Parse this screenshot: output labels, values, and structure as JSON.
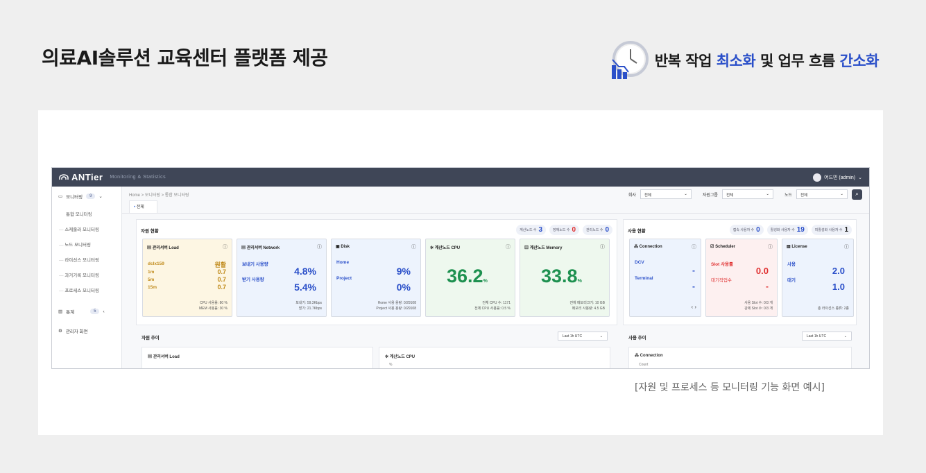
{
  "headline": "의료AI솔루션 교육센터 플랫폼 제공",
  "tagline": {
    "p1": "반복 작업 ",
    "h1": "최소화",
    "p2": " 및 업무 흐름 ",
    "h2": "간소화"
  },
  "caption": "[자원 및 프로세스 등 모니터링 기능 화면 예시]",
  "app": {
    "logo": "ANTier",
    "logo_sub": "Monitoring & Statistics",
    "user": "어드민 (admin)",
    "sidebar": {
      "monitoring": "모니터링",
      "monitoring_count": "9",
      "items": [
        "통합 모니터링",
        "스케줄러 모니터링",
        "노드 모니터링",
        "라이선스 모니터링",
        "과거기록 모니터링",
        "프로세스 모니터링"
      ],
      "stats": "통계",
      "stats_count": "5",
      "admin": "관리자 화면"
    },
    "breadcrumb": "Home  >  모니터링  >  통합 모니터링",
    "filters": {
      "company_label": "회사",
      "company_value": "전체",
      "group_label": "자원그룹",
      "group_value": "전체",
      "node_label": "노드",
      "node_value": "전체"
    },
    "tab": "전체",
    "resource": {
      "title": "자원 현황",
      "chips": [
        {
          "label": "계산노드 수",
          "value": "3"
        },
        {
          "label": "장애노드 수",
          "value": "0"
        },
        {
          "label": "관리노드 수",
          "value": "0"
        }
      ],
      "load": {
        "title": "관리서버 Load",
        "host": "dclx159",
        "status": "원활",
        "rows": [
          {
            "k": "1m",
            "v": "0.7"
          },
          {
            "k": "5m",
            "v": "0.7"
          },
          {
            "k": "15m",
            "v": "0.7"
          }
        ],
        "foot1": "CPU 사용률: 80 %",
        "foot2": "MEM 사용률: 30 %"
      },
      "network": {
        "title": "관리서버 Network",
        "send_label": "보내기 사용량",
        "send_value": "4.8%",
        "recv_label": "받기 사용량",
        "recv_value": "5.4%",
        "foot1": "보내기: 59.3Kbps",
        "foot2": "받기: 21.7Kbps"
      },
      "disk": {
        "title": "Disk",
        "home_label": "Home",
        "home_value": "9%",
        "project_label": "Project",
        "project_value": "0%",
        "foot1": "Home 사용 용량: 0/29108",
        "foot2": "Project 사용 용량: 0/29108"
      },
      "cpu": {
        "title": "계산노드 CPU",
        "value": "36.2",
        "unit": "%",
        "foot1": "전체 CPU 수: 1171",
        "foot2": "전체 CPU 사용률: 0.5 %"
      },
      "memory": {
        "title": "계산노드 Memory",
        "value": "33.8",
        "unit": "%",
        "foot1": "전체 메모리크기: 10 GB",
        "foot2": "메모리 사용량: 4.5 GB"
      }
    },
    "usage": {
      "title": "사용 현황",
      "chips": [
        {
          "label": "접속 사용자 수",
          "value": "0"
        },
        {
          "label": "활성화 사용자 수",
          "value": "19"
        },
        {
          "label": "미활성화 사용자 수",
          "value": "1"
        }
      ],
      "connection": {
        "title": "Connection",
        "l1": "DCV",
        "v1": "-",
        "l2": "Terminal",
        "v2": "-",
        "nav": "‹   ›"
      },
      "scheduler": {
        "title": "Scheduler",
        "l1": "Slot 사용률",
        "v1": "0.0",
        "l2": "대기작업수",
        "v2": "-",
        "foot1": "사용 Slot 수: 0/3 개",
        "foot2": "강제 Slot 수: 0/3 개"
      },
      "license": {
        "title": "License",
        "l1": "사용",
        "v1": "2.0",
        "l2": "대기",
        "v2": "1.0",
        "foot1": "총 라이선스 종류: 2종"
      }
    },
    "trend": {
      "resource_title": "자원 추이",
      "usage_title": "사용 추이",
      "range": "Last 1h UTC",
      "load_title": "관리서버 Load",
      "cpu_title": "계산노드 CPU",
      "cpu_unit": "%",
      "conn_title": "Connection",
      "conn_sub": "Count"
    }
  },
  "colors": {
    "accent": "#2a4fc9",
    "green": "#1e9150",
    "red": "#e03030",
    "topbar": "#3f4657",
    "gold": "#c08a1a"
  }
}
